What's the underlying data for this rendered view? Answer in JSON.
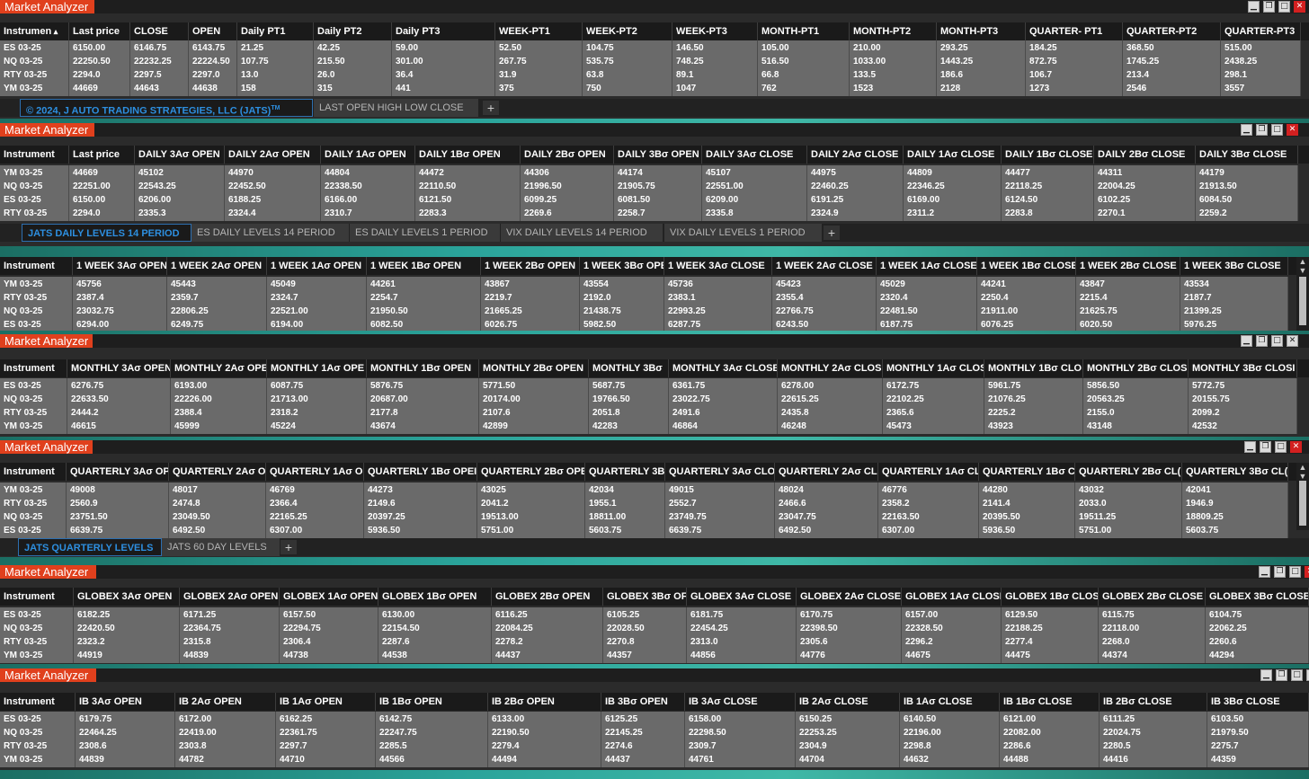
{
  "window_title": "Market Analyzer",
  "colors": {
    "title_bg": "#e0401d",
    "active_tab": "#2d8fe0",
    "cell_bg": "#6a6a6a",
    "header_bg": "#1a1a1a"
  },
  "icons": [
    "minimize-icon",
    "restore-icon",
    "maximize-icon",
    "close-icon",
    "plus-icon",
    "scroll-up-icon",
    "scroll-down-icon",
    "sort-asc-icon"
  ],
  "panels": [
    {
      "title": "Market Analyzer",
      "headers": [
        "Instrumen",
        "Last price",
        "CLOSE",
        "OPEN",
        "Daily PT1",
        "Daily PT2",
        "Daily PT3",
        "WEEK-PT1",
        "WEEK-PT2",
        "WEEK-PT3",
        "MONTH-PT1",
        "MONTH-PT2",
        "MONTH-PT3",
        "QUARTER- PT1",
        "QUARTER-PT2",
        "QUARTER-PT3"
      ],
      "rows": [
        [
          "ES 03-25",
          "6150.00",
          "6146.75",
          "6143.75",
          "21.25",
          "42.25",
          "59.00",
          "52.50",
          "104.75",
          "146.50",
          "105.00",
          "210.00",
          "293.25",
          "184.25",
          "368.50",
          "515.00"
        ],
        [
          "NQ 03-25",
          "22250.50",
          "22232.25",
          "22224.50",
          "107.75",
          "215.50",
          "301.00",
          "267.75",
          "535.75",
          "748.25",
          "516.50",
          "1033.00",
          "1443.25",
          "872.75",
          "1745.25",
          "2438.25"
        ],
        [
          "RTY 03-25",
          "2294.0",
          "2297.5",
          "2297.0",
          "13.0",
          "26.0",
          "36.4",
          "31.9",
          "63.8",
          "89.1",
          "66.8",
          "133.5",
          "186.6",
          "106.7",
          "213.4",
          "298.1"
        ],
        [
          "YM 03-25",
          "44669",
          "44643",
          "44638",
          "158",
          "315",
          "441",
          "375",
          "750",
          "1047",
          "762",
          "1523",
          "2128",
          "1273",
          "2546",
          "3557"
        ]
      ],
      "tabs": [
        "© 2024, J AUTO TRADING STRATEGIES, LLC (JATS)",
        "LAST OPEN HIGH LOW CLOSE"
      ],
      "tab_trademark": "TM"
    },
    {
      "title": "Market Analyzer",
      "headers": [
        "Instrument",
        "Last price",
        "DAILY 3Aσ OPEN",
        "DAILY 2Aσ OPEN",
        "DAILY 1Aσ OPEN",
        "DAILY 1Bσ OPEN",
        "DAILY 2Bσ OPEN",
        "DAILY 3Bσ OPEN",
        "DAILY 3Aσ CLOSE",
        "DAILY 2Aσ CLOSE",
        "DAILY 1Aσ CLOSE",
        "DAILY 1Bσ CLOSE",
        "DAILY 2Bσ CLOSE",
        "DAILY 3Bσ CLOSE"
      ],
      "rows": [
        [
          "YM 03-25",
          "44669",
          "45102",
          "44970",
          "44804",
          "44472",
          "44306",
          "44174",
          "45107",
          "44975",
          "44809",
          "44477",
          "44311",
          "44179"
        ],
        [
          "NQ 03-25",
          "22251.00",
          "22543.25",
          "22452.50",
          "22338.50",
          "22110.50",
          "21996.50",
          "21905.75",
          "22551.00",
          "22460.25",
          "22346.25",
          "22118.25",
          "22004.25",
          "21913.50"
        ],
        [
          "ES 03-25",
          "6150.00",
          "6206.00",
          "6188.25",
          "6166.00",
          "6121.50",
          "6099.25",
          "6081.50",
          "6209.00",
          "6191.25",
          "6169.00",
          "6124.50",
          "6102.25",
          "6084.50"
        ],
        [
          "RTY 03-25",
          "2294.0",
          "2335.3",
          "2324.4",
          "2310.7",
          "2283.3",
          "2269.6",
          "2258.7",
          "2335.8",
          "2324.9",
          "2311.2",
          "2283.8",
          "2270.1",
          "2259.2"
        ]
      ],
      "tabs": [
        "JATS DAILY LEVELS 14 PERIOD",
        "ES DAILY LEVELS 14 PERIOD",
        "ES DAILY LEVELS 1 PERIOD",
        "VIX DAILY LEVELS 14 PERIOD",
        "VIX DAILY LEVELS 1 PERIOD"
      ]
    },
    {
      "title": "",
      "headers": [
        "Instrument",
        "1 WEEK 3Aσ OPEN",
        "1 WEEK 2Aσ OPEN",
        "1 WEEK 1Aσ OPEN",
        "1 WEEK 1Bσ OPEN",
        "1 WEEK 2Bσ OPEN",
        "1 WEEK 3Bσ OPE",
        "1 WEEK 3Aσ CLOSE",
        "1 WEEK 2Aσ CLOSE",
        "1 WEEK 1Aσ CLOSE",
        "1 WEEK 1Bσ CLOSE",
        "1 WEEK 2Bσ CLOSE",
        "1 WEEK 3Bσ CLOSE"
      ],
      "rows": [
        [
          "YM 03-25",
          "45756",
          "45443",
          "45049",
          "44261",
          "43867",
          "43554",
          "45736",
          "45423",
          "45029",
          "44241",
          "43847",
          "43534"
        ],
        [
          "RTY 03-25",
          "2387.4",
          "2359.7",
          "2324.7",
          "2254.7",
          "2219.7",
          "2192.0",
          "2383.1",
          "2355.4",
          "2320.4",
          "2250.4",
          "2215.4",
          "2187.7"
        ],
        [
          "NQ 03-25",
          "23032.75",
          "22806.25",
          "22521.00",
          "21950.50",
          "21665.25",
          "21438.75",
          "22993.25",
          "22766.75",
          "22481.50",
          "21911.00",
          "21625.75",
          "21399.25"
        ],
        [
          "ES 03-25",
          "6294.00",
          "6249.75",
          "6194.00",
          "6082.50",
          "6026.75",
          "5982.50",
          "6287.75",
          "6243.50",
          "6187.75",
          "6076.25",
          "6020.50",
          "5976.25"
        ]
      ]
    },
    {
      "title": "Market Analyzer",
      "headers": [
        "Instrument",
        "MONTHLY 3Aσ OPEN",
        "MONTHLY 2Aσ OPE",
        "MONTHLY 1Aσ OPE",
        "MONTHLY 1Bσ OPEN",
        "MONTHLY 2Bσ OPEN",
        "MONTHLY 3Bσ",
        "MONTHLY 3Aσ CLOSE",
        "MONTHLY 2Aσ CLOS",
        "MONTHLY 1Aσ CLOS",
        "MONTHLY 1Bσ CLO",
        "MONTHLY 2Bσ CLOSI",
        "MONTHLY 3Bσ CLOSI"
      ],
      "rows": [
        [
          "ES 03-25",
          "6276.75",
          "6193.00",
          "6087.75",
          "5876.75",
          "5771.50",
          "5687.75",
          "6361.75",
          "6278.00",
          "6172.75",
          "5961.75",
          "5856.50",
          "5772.75"
        ],
        [
          "NQ 03-25",
          "22633.50",
          "22226.00",
          "21713.00",
          "20687.00",
          "20174.00",
          "19766.50",
          "23022.75",
          "22615.25",
          "22102.25",
          "21076.25",
          "20563.25",
          "20155.75"
        ],
        [
          "RTY 03-25",
          "2444.2",
          "2388.4",
          "2318.2",
          "2177.8",
          "2107.6",
          "2051.8",
          "2491.6",
          "2435.8",
          "2365.6",
          "2225.2",
          "2155.0",
          "2099.2"
        ],
        [
          "YM 03-25",
          "46615",
          "45999",
          "45224",
          "43674",
          "42899",
          "42283",
          "46864",
          "46248",
          "45473",
          "43923",
          "43148",
          "42532"
        ]
      ]
    },
    {
      "title": "Market Analyzer",
      "headers": [
        "Instrument",
        "QUARTERLY 3Aσ OP",
        "QUARTERLY 2Aσ OI",
        "QUARTERLY 1Aσ OI",
        "QUARTERLY 1Bσ OPEI",
        "QUARTERLY 2Bσ OPE",
        "QUARTERLY 3B",
        "QUARTERLY 3Aσ CLO",
        "QUARTERLY 2Aσ CL(",
        "QUARTERLY 1Aσ CL",
        "QUARTERLY 1Bσ C",
        "QUARTERLY 2Bσ CL(",
        "QUARTERLY 3Bσ CL("
      ],
      "rows": [
        [
          "YM 03-25",
          "49008",
          "48017",
          "46769",
          "44273",
          "43025",
          "42034",
          "49015",
          "48024",
          "46776",
          "44280",
          "43032",
          "42041"
        ],
        [
          "RTY 03-25",
          "2560.9",
          "2474.8",
          "2366.4",
          "2149.6",
          "2041.2",
          "1955.1",
          "2552.7",
          "2466.6",
          "2358.2",
          "2141.4",
          "2033.0",
          "1946.9"
        ],
        [
          "NQ 03-25",
          "23751.50",
          "23049.50",
          "22165.25",
          "20397.25",
          "19513.00",
          "18811.00",
          "23749.75",
          "23047.75",
          "22163.50",
          "20395.50",
          "19511.25",
          "18809.25"
        ],
        [
          "ES 03-25",
          "6639.75",
          "6492.50",
          "6307.00",
          "5936.50",
          "5751.00",
          "5603.75",
          "6639.75",
          "6492.50",
          "6307.00",
          "5936.50",
          "5751.00",
          "5603.75"
        ]
      ],
      "tabs": [
        "JATS QUARTERLY LEVELS",
        "JATS 60 DAY LEVELS"
      ]
    },
    {
      "title": "Market Analyzer",
      "headers": [
        "Instrument",
        "GLOBEX 3Aσ OPEN",
        "GLOBEX 2Aσ OPEN",
        "GLOBEX 1Aσ OPEN",
        "GLOBEX 1Bσ OPEN",
        "GLOBEX 2Bσ OPEN",
        "GLOBEX 3Bσ OF",
        "GLOBEX 3Aσ CLOSE",
        "GLOBEX 2Aσ CLOSE",
        "GLOBEX 1Aσ CLOSE",
        "GLOBEX 1Bσ CLOS",
        "GLOBEX 2Bσ CLOSE",
        "GLOBEX 3Bσ CLOSE"
      ],
      "rows": [
        [
          "ES 03-25",
          "6182.25",
          "6171.25",
          "6157.50",
          "6130.00",
          "6116.25",
          "6105.25",
          "6181.75",
          "6170.75",
          "6157.00",
          "6129.50",
          "6115.75",
          "6104.75"
        ],
        [
          "NQ 03-25",
          "22420.50",
          "22364.75",
          "22294.75",
          "22154.50",
          "22084.25",
          "22028.50",
          "22454.25",
          "22398.50",
          "22328.50",
          "22188.25",
          "22118.00",
          "22062.25"
        ],
        [
          "RTY 03-25",
          "2323.2",
          "2315.8",
          "2306.4",
          "2287.6",
          "2278.2",
          "2270.8",
          "2313.0",
          "2305.6",
          "2296.2",
          "2277.4",
          "2268.0",
          "2260.6"
        ],
        [
          "YM 03-25",
          "44919",
          "44839",
          "44738",
          "44538",
          "44437",
          "44357",
          "44856",
          "44776",
          "44675",
          "44475",
          "44374",
          "44294"
        ]
      ]
    },
    {
      "title": "Market Analyzer",
      "headers": [
        "Instrument",
        "IB 3Aσ OPEN",
        "IB 2Aσ OPEN",
        "IB 1Aσ OPEN",
        "IB 1Bσ OPEN",
        "IB 2Bσ OPEN",
        "IB 3Bσ OPEN",
        "IB 3Aσ CLOSE",
        "IB 2Aσ CLOSE",
        "IB 1Aσ CLOSE",
        "IB 1Bσ CLOSE",
        "IB 2Bσ CLOSE",
        "IB 3Bσ CLOSE"
      ],
      "rows": [
        [
          "ES 03-25",
          "6179.75",
          "6172.00",
          "6162.25",
          "6142.75",
          "6133.00",
          "6125.25",
          "6158.00",
          "6150.25",
          "6140.50",
          "6121.00",
          "6111.25",
          "6103.50"
        ],
        [
          "NQ 03-25",
          "22464.25",
          "22419.00",
          "22361.75",
          "22247.75",
          "22190.50",
          "22145.25",
          "22298.50",
          "22253.25",
          "22196.00",
          "22082.00",
          "22024.75",
          "21979.50"
        ],
        [
          "RTY 03-25",
          "2308.6",
          "2303.8",
          "2297.7",
          "2285.5",
          "2279.4",
          "2274.6",
          "2309.7",
          "2304.9",
          "2298.8",
          "2286.6",
          "2280.5",
          "2275.7"
        ],
        [
          "YM 03-25",
          "44839",
          "44782",
          "44710",
          "44566",
          "44494",
          "44437",
          "44761",
          "44704",
          "44632",
          "44488",
          "44416",
          "44359"
        ]
      ]
    }
  ]
}
